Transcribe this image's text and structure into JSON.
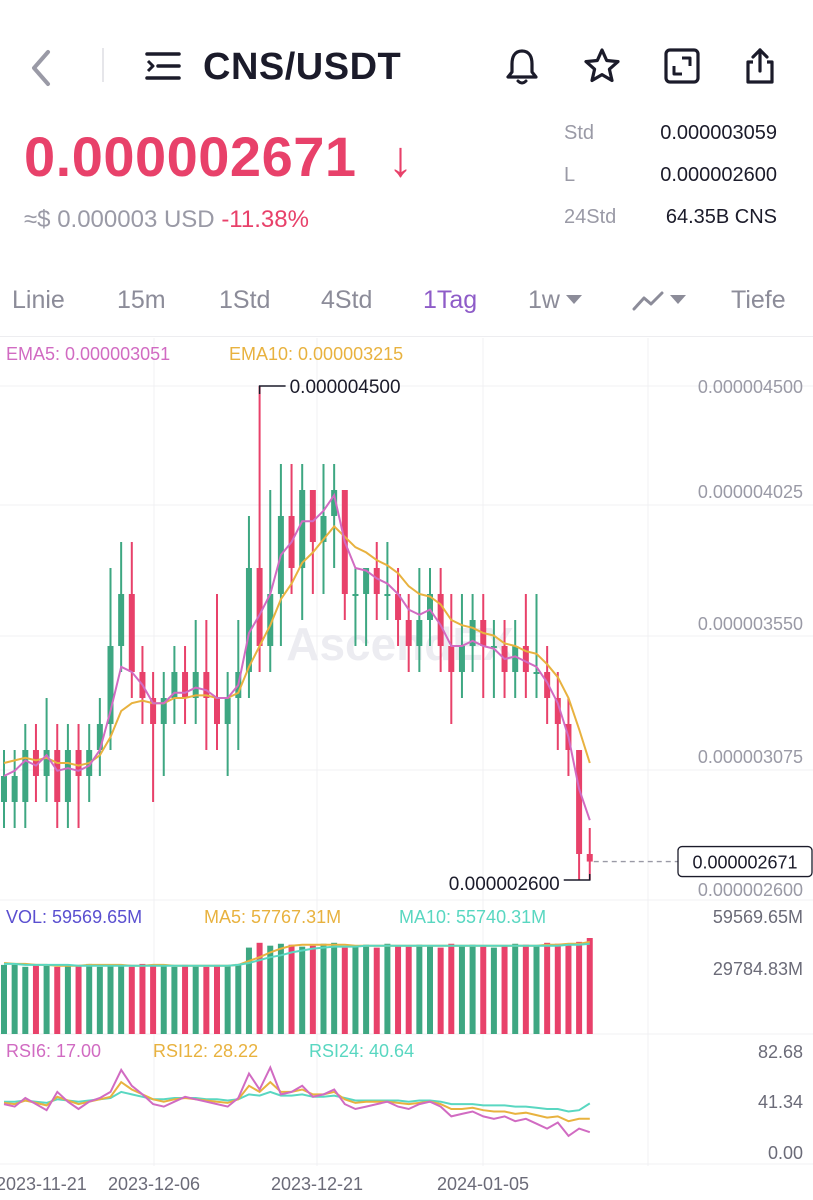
{
  "header": {
    "title": "CNS/USDT"
  },
  "price": {
    "last": "0.000002671",
    "arrow": "↓",
    "usd_approx": "≈$ 0.000003 USD",
    "change_pct": "-11.38%"
  },
  "stats": [
    {
      "label": "Std",
      "value": "0.000003059"
    },
    {
      "label": "L",
      "value": "0.000002600"
    },
    {
      "label": "24Std",
      "value": "64.35B CNS"
    }
  ],
  "tabs": [
    {
      "label": "Linie",
      "active": false
    },
    {
      "label": "15m",
      "active": false
    },
    {
      "label": "1Std",
      "active": false
    },
    {
      "label": "4Std",
      "active": false
    },
    {
      "label": "1Tag",
      "active": true
    },
    {
      "label": "1w",
      "active": false,
      "caret": true
    },
    {
      "label": "",
      "active": false,
      "caret": true,
      "icon": "line-chart-icon"
    },
    {
      "label": "Tiefe",
      "active": false
    }
  ],
  "icons": [
    "back-icon",
    "menu-icon",
    "bell-icon",
    "star-icon",
    "fullscreen-icon",
    "share-icon"
  ],
  "colors": {
    "up": "#3ea782",
    "down": "#e8416a",
    "ema5": "#d16bc2",
    "ema10": "#e8b23f",
    "ma10": "#59d7c1",
    "vol": "#5a4fd0",
    "price": "#e8416a",
    "active_tab": "#8e5cc8"
  },
  "chart_data": {
    "type": "candlestick",
    "watermark": "AscendEX",
    "price_panel": {
      "legend": [
        {
          "label": "EMA5: 0.000003051",
          "color": "#d16bc2"
        },
        {
          "label": "EMA10: 0.000003215",
          "color": "#e8b23f"
        }
      ],
      "y_ticks": [
        "0.000004500",
        "0.000004025",
        "0.000003550",
        "0.000003075",
        "0.000002600"
      ],
      "ylim": [
        2.6e-06,
        4.5e-06
      ],
      "high_marker": "0.000004500",
      "low_marker": "0.000002600",
      "last_price_tag": "0.000002671"
    },
    "volume_panel": {
      "legend": [
        {
          "label": "VOL: 59569.65M",
          "color": "#5a4fd0"
        },
        {
          "label": "MA5: 57767.31M",
          "color": "#e8b23f"
        },
        {
          "label": "MA10: 55740.31M",
          "color": "#59d7c1"
        }
      ],
      "y_ticks": [
        "59569.65M",
        "29784.83M"
      ]
    },
    "rsi_panel": {
      "legend": [
        {
          "label": "RSI6: 17.00",
          "color": "#d16bc2"
        },
        {
          "label": "RSI12: 28.22",
          "color": "#e8b23f"
        },
        {
          "label": "RSI24: 40.64",
          "color": "#59d7c1"
        }
      ],
      "y_ticks": [
        "82.68",
        "41.34",
        "0.00"
      ]
    },
    "x_ticks": [
      "2023-11-21",
      "2023-12-06",
      "2023-12-21",
      "2024-01-05"
    ],
    "candles": [
      [
        2.9e-06,
        3e-06,
        3.1e-06,
        2.8e-06
      ],
      [
        2.9e-06,
        3e-06,
        3.1e-06,
        2.8e-06
      ],
      [
        2.9e-06,
        3.1e-06,
        3.2e-06,
        2.8e-06
      ],
      [
        3.1e-06,
        3e-06,
        3.2e-06,
        2.9e-06
      ],
      [
        3e-06,
        3.1e-06,
        3.3e-06,
        2.9e-06
      ],
      [
        3.1e-06,
        2.9e-06,
        3.2e-06,
        2.8e-06
      ],
      [
        2.9e-06,
        3.1e-06,
        3.2e-06,
        2.8e-06
      ],
      [
        3.1e-06,
        3e-06,
        3.2e-06,
        2.8e-06
      ],
      [
        3e-06,
        3.1e-06,
        3.2e-06,
        2.9e-06
      ],
      [
        3.1e-06,
        3.2e-06,
        3.3e-06,
        3e-06
      ],
      [
        3.2e-06,
        3.5e-06,
        3.8e-06,
        3.1e-06
      ],
      [
        3.5e-06,
        3.7e-06,
        3.9e-06,
        3.4e-06
      ],
      [
        3.7e-06,
        3.4e-06,
        3.9e-06,
        3.3e-06
      ],
      [
        3.4e-06,
        3.3e-06,
        3.5e-06,
        3.2e-06
      ],
      [
        3.3e-06,
        3.2e-06,
        3.4e-06,
        2.9e-06
      ],
      [
        3.2e-06,
        3.3e-06,
        3.4e-06,
        3e-06
      ],
      [
        3.3e-06,
        3.4e-06,
        3.5e-06,
        3.2e-06
      ],
      [
        3.4e-06,
        3.3e-06,
        3.5e-06,
        3.2e-06
      ],
      [
        3.3e-06,
        3.4e-06,
        3.6e-06,
        3.2e-06
      ],
      [
        3.4e-06,
        3.3e-06,
        3.6e-06,
        3.1e-06
      ],
      [
        3.3e-06,
        3.2e-06,
        3.7e-06,
        3.1e-06
      ],
      [
        3.2e-06,
        3.3e-06,
        3.4e-06,
        3e-06
      ],
      [
        3.3e-06,
        3.4e-06,
        3.6e-06,
        3.1e-06
      ],
      [
        3.4e-06,
        3.8e-06,
        4e-06,
        3.3e-06
      ],
      [
        3.8e-06,
        3.5e-06,
        4.5e-06,
        3.4e-06
      ],
      [
        3.5e-06,
        3.7e-06,
        4.1e-06,
        3.4e-06
      ],
      [
        3.7e-06,
        4e-06,
        4.2e-06,
        3.5e-06
      ],
      [
        4e-06,
        3.8e-06,
        4.2e-06,
        3.7e-06
      ],
      [
        3.8e-06,
        4.1e-06,
        4.2e-06,
        3.6e-06
      ],
      [
        4.1e-06,
        3.9e-06,
        4.1e-06,
        3.7e-06
      ],
      [
        3.9e-06,
        4e-06,
        4.2e-06,
        3.7e-06
      ],
      [
        4e-06,
        4.1e-06,
        4.2e-06,
        3.8e-06
      ],
      [
        4.1e-06,
        3.7e-06,
        4.1e-06,
        3.6e-06
      ],
      [
        3.7e-06,
        3.7e-06,
        3.8e-06,
        3.5e-06
      ],
      [
        3.7e-06,
        3.8e-06,
        3.8e-06,
        3.5e-06
      ],
      [
        3.8e-06,
        3.7e-06,
        3.9e-06,
        3.6e-06
      ],
      [
        3.7e-06,
        3.7e-06,
        3.9e-06,
        3.6e-06
      ],
      [
        3.7e-06,
        3.6e-06,
        3.8e-06,
        3.5e-06
      ],
      [
        3.6e-06,
        3.5e-06,
        3.7e-06,
        3.4e-06
      ],
      [
        3.5e-06,
        3.6e-06,
        3.8e-06,
        3.4e-06
      ],
      [
        3.6e-06,
        3.7e-06,
        3.8e-06,
        3.5e-06
      ],
      [
        3.7e-06,
        3.5e-06,
        3.8e-06,
        3.4e-06
      ],
      [
        3.5e-06,
        3.4e-06,
        3.7e-06,
        3.2e-06
      ],
      [
        3.4e-06,
        3.5e-06,
        3.7e-06,
        3.3e-06
      ],
      [
        3.5e-06,
        3.6e-06,
        3.7e-06,
        3.4e-06
      ],
      [
        3.6e-06,
        3.5e-06,
        3.7e-06,
        3.3e-06
      ],
      [
        3.5e-06,
        3.5e-06,
        3.6e-06,
        3.3e-06
      ],
      [
        3.5e-06,
        3.4e-06,
        3.6e-06,
        3.3e-06
      ],
      [
        3.4e-06,
        3.5e-06,
        3.6e-06,
        3.3e-06
      ],
      [
        3.5e-06,
        3.4e-06,
        3.7e-06,
        3.3e-06
      ],
      [
        3.4e-06,
        3.4e-06,
        3.7e-06,
        3.3e-06
      ],
      [
        3.4e-06,
        3.3e-06,
        3.5e-06,
        3.2e-06
      ],
      [
        3.3e-06,
        3.2e-06,
        3.4e-06,
        3.1e-06
      ],
      [
        3.2e-06,
        3.1e-06,
        3.3e-06,
        3e-06
      ],
      [
        3.1e-06,
        2.7e-06,
        3.1e-06,
        2.6e-06
      ],
      [
        2.7e-06,
        2.671e-06,
        2.8e-06,
        2.6e-06
      ]
    ],
    "ema5": [
      3.0,
      3.02,
      3.06,
      3.04,
      3.08,
      3.02,
      3.03,
      3.02,
      3.04,
      3.1,
      3.25,
      3.42,
      3.4,
      3.35,
      3.28,
      3.28,
      3.32,
      3.32,
      3.34,
      3.33,
      3.3,
      3.3,
      3.35,
      3.55,
      3.62,
      3.7,
      3.85,
      3.9,
      3.98,
      3.98,
      4.02,
      4.08,
      3.9,
      3.8,
      3.79,
      3.76,
      3.74,
      3.7,
      3.64,
      3.62,
      3.64,
      3.58,
      3.5,
      3.5,
      3.52,
      3.5,
      3.49,
      3.45,
      3.46,
      3.44,
      3.42,
      3.36,
      3.28,
      3.15,
      2.95,
      2.83
    ],
    "ema10": [
      3.05,
      3.06,
      3.07,
      3.06,
      3.07,
      3.05,
      3.05,
      3.04,
      3.05,
      3.08,
      3.15,
      3.25,
      3.28,
      3.29,
      3.28,
      3.28,
      3.3,
      3.3,
      3.31,
      3.31,
      3.3,
      3.3,
      3.32,
      3.42,
      3.5,
      3.58,
      3.68,
      3.74,
      3.82,
      3.86,
      3.91,
      3.96,
      3.92,
      3.88,
      3.86,
      3.83,
      3.81,
      3.78,
      3.73,
      3.7,
      3.69,
      3.66,
      3.6,
      3.58,
      3.57,
      3.55,
      3.54,
      3.51,
      3.5,
      3.48,
      3.47,
      3.43,
      3.38,
      3.3,
      3.18,
      3.05
    ],
    "volume": [
      0.72,
      0.72,
      0.7,
      0.72,
      0.71,
      0.7,
      0.72,
      0.71,
      0.73,
      0.7,
      0.72,
      0.71,
      0.7,
      0.73,
      0.72,
      0.71,
      0.7,
      0.72,
      0.71,
      0.7,
      0.72,
      0.71,
      0.73,
      0.9,
      0.95,
      0.92,
      0.94,
      0.93,
      0.91,
      0.92,
      0.94,
      0.95,
      0.9,
      0.92,
      0.93,
      0.9,
      0.94,
      0.92,
      0.91,
      0.93,
      0.92,
      0.9,
      0.94,
      0.92,
      0.93,
      0.91,
      0.9,
      0.92,
      0.94,
      0.93,
      0.92,
      0.95,
      0.94,
      0.93,
      0.96,
      1.0
    ],
    "vol_ma5": [
      0.74,
      0.73,
      0.73,
      0.72,
      0.72,
      0.71,
      0.71,
      0.71,
      0.72,
      0.72,
      0.72,
      0.72,
      0.71,
      0.71,
      0.72,
      0.72,
      0.71,
      0.71,
      0.71,
      0.71,
      0.71,
      0.71,
      0.72,
      0.76,
      0.8,
      0.85,
      0.89,
      0.92,
      0.93,
      0.93,
      0.93,
      0.93,
      0.93,
      0.92,
      0.92,
      0.92,
      0.92,
      0.92,
      0.92,
      0.92,
      0.92,
      0.92,
      0.92,
      0.92,
      0.92,
      0.92,
      0.92,
      0.92,
      0.92,
      0.92,
      0.92,
      0.93,
      0.93,
      0.94,
      0.94,
      0.96
    ],
    "vol_ma10": [
      0.73,
      0.73,
      0.72,
      0.72,
      0.72,
      0.72,
      0.72,
      0.71,
      0.71,
      0.71,
      0.71,
      0.71,
      0.71,
      0.71,
      0.71,
      0.71,
      0.71,
      0.71,
      0.71,
      0.71,
      0.71,
      0.71,
      0.72,
      0.74,
      0.77,
      0.8,
      0.82,
      0.85,
      0.87,
      0.89,
      0.9,
      0.91,
      0.91,
      0.91,
      0.92,
      0.92,
      0.92,
      0.92,
      0.92,
      0.92,
      0.92,
      0.92,
      0.92,
      0.92,
      0.92,
      0.92,
      0.92,
      0.92,
      0.92,
      0.92,
      0.92,
      0.92,
      0.92,
      0.93,
      0.93,
      0.94
    ],
    "rsi6": [
      40,
      38,
      45,
      40,
      35,
      50,
      42,
      36,
      42,
      45,
      50,
      68,
      55,
      48,
      40,
      38,
      42,
      46,
      44,
      42,
      40,
      38,
      45,
      65,
      52,
      70,
      48,
      50,
      55,
      46,
      48,
      52,
      40,
      36,
      38,
      40,
      42,
      38,
      36,
      40,
      42,
      38,
      30,
      32,
      34,
      30,
      28,
      30,
      26,
      28,
      24,
      20,
      25,
      14,
      20,
      17
    ],
    "rsi12": [
      41,
      40,
      43,
      41,
      39,
      46,
      43,
      40,
      42,
      44,
      46,
      58,
      52,
      48,
      44,
      42,
      44,
      45,
      44,
      43,
      42,
      41,
      44,
      55,
      50,
      58,
      50,
      50,
      52,
      48,
      48,
      50,
      44,
      41,
      42,
      42,
      42,
      41,
      40,
      41,
      42,
      40,
      36,
      36,
      37,
      35,
      34,
      34,
      32,
      33,
      31,
      29,
      30,
      26,
      28,
      28
    ],
    "rsi24": [
      42,
      42,
      43,
      42,
      41,
      44,
      43,
      42,
      43,
      44,
      45,
      50,
      48,
      46,
      44,
      44,
      45,
      45,
      45,
      44,
      44,
      43,
      44,
      48,
      47,
      50,
      47,
      47,
      48,
      46,
      46,
      47,
      45,
      43,
      43,
      43,
      43,
      43,
      42,
      43,
      43,
      42,
      40,
      40,
      40,
      39,
      39,
      39,
      38,
      38,
      37,
      36,
      36,
      34,
      35,
      40.64
    ]
  }
}
